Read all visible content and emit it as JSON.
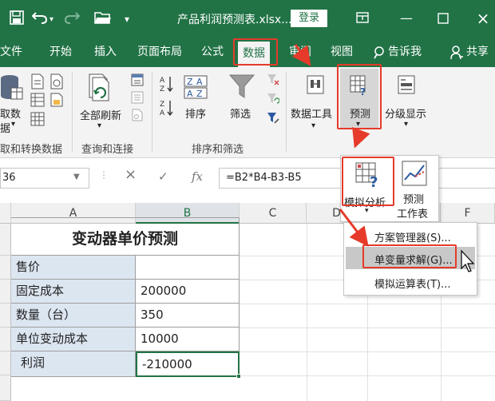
{
  "titlebar": {
    "document_title": "产品利润预测表.xlsx...",
    "login_label": "登录",
    "save_icon": "save-icon",
    "undo_icon": "undo-icon",
    "redo_icon": "redo-icon",
    "folder_icon": "folder-open-icon",
    "restore_icon": "ribbon-display-icon",
    "minimize_icon": "minimize-icon",
    "maximize_icon": "maximize-icon",
    "close_icon": "close-icon",
    "accent_color": "#217346"
  },
  "ribbon_tabs": [
    "文件",
    "开始",
    "插入",
    "页面布局",
    "公式",
    "数据",
    "审阅",
    "视图"
  ],
  "tell_me": "告诉我",
  "share": "共享",
  "active_tab": "数据",
  "ribbon": {
    "get_data_line1": "取数",
    "get_data_line2": "据",
    "group_get_transform": "取和转换数据",
    "refresh_all": "全部刷新",
    "group_queries": "查询和连接",
    "sort": "排序",
    "filter": "筛选",
    "group_sort_filter": "排序和筛选",
    "data_tools": "数据工具",
    "forecast": "预测",
    "outline": "分级显示"
  },
  "formula_bar": {
    "name_box": "36",
    "cancel_icon": "×",
    "enter_icon": "✓",
    "fx_icon": "fx",
    "formula": "=B2*B4-B3-B5"
  },
  "columns": [
    "A",
    "B",
    "C",
    "D",
    "E",
    "F"
  ],
  "sheet": {
    "title": "变动器单价预测",
    "rows": [
      {
        "label": "售价",
        "value": ""
      },
      {
        "label": "固定成本",
        "value": "200000"
      },
      {
        "label": "数量（台）",
        "value": "350"
      },
      {
        "label": "单位变动成本",
        "value": "10000"
      },
      {
        "label": "利润",
        "value": "-210000"
      }
    ]
  },
  "forecast_dropdown": {
    "what_if": "模拟分析",
    "forecast_sheet_line1": "预测",
    "forecast_sheet_line2": "工作表"
  },
  "what_if_menu": {
    "items": [
      "方案管理器(S)...",
      "单变量求解(G)...",
      "模拟运算表(T)..."
    ]
  },
  "highlight_color": "#e63a2a"
}
